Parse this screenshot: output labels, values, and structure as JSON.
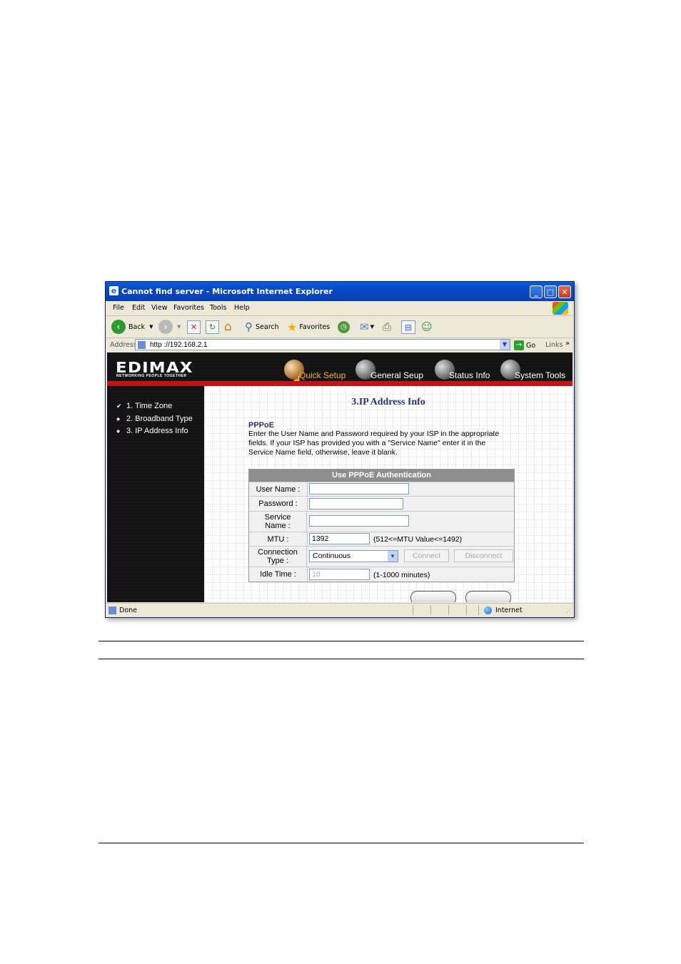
{
  "window": {
    "title": "Cannot find server - Microsoft Internet Explorer",
    "menu": [
      "File",
      "Edit",
      "View",
      "Favorites",
      "Tools",
      "Help"
    ],
    "toolbar": {
      "back": "Back",
      "search": "Search",
      "favorites": "Favorites"
    },
    "address": {
      "label": "Address",
      "url": "http ://192.168.2.1",
      "go": "Go",
      "links": "Links"
    },
    "status": {
      "text": "Done",
      "zone": "Internet"
    }
  },
  "router": {
    "logo": "EDIMAX",
    "tagline": "NETWORKING PEOPLE TOGETHER",
    "tabs": [
      "Quick Setup",
      "General Seup",
      "Status Info",
      "System Tools"
    ],
    "active_tab": "Quick Setup",
    "steps": [
      "1. Time Zone",
      "2. Broadband Type",
      "3. IP Address Info"
    ],
    "page_title": "3.IP Address Info",
    "section_title": "PPPoE",
    "description": "Enter the User Name and Password required by your ISP in the appropriate fields. If your ISP has provided you with a \"Service Name\" enter it in the Service Name field, otherwise, leave it blank.",
    "form": {
      "header": "Use PPPoE Authentication",
      "user_name_label": "User Name :",
      "password_label": "Password :",
      "service_name_label": "Service Name :",
      "mtu_label": "MTU :",
      "mtu_value": "1392",
      "mtu_hint": "(512<=MTU Value<=1492)",
      "connection_type_label": "Connection Type :",
      "connection_type_value": "Continuous",
      "connect_button": "Connect",
      "disconnect_button": "Disconnect",
      "idle_time_label": "Idle Time :",
      "idle_time_value": "10",
      "idle_time_hint": "(1-1000 minutes)"
    }
  },
  "colors": {
    "accent_red": "#c0141c",
    "title_blue": "#28337a",
    "xp_blue": "#0349c4"
  }
}
